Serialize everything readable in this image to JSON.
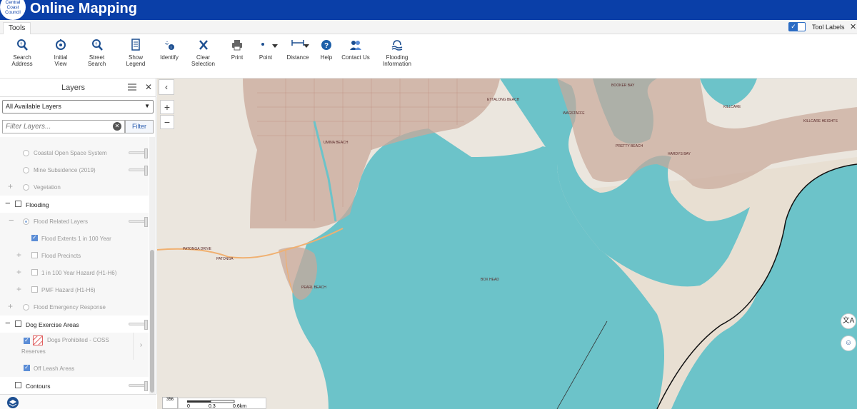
{
  "header": {
    "logo_lines": [
      "Central",
      "Coast",
      "Council"
    ],
    "title": "Online Mapping",
    "bg_color": "#0a3fa8"
  },
  "tabstrip": {
    "tab_label": "Tools",
    "tool_labels_text": "Tool Labels",
    "tool_labels_on": true,
    "close": "✕"
  },
  "toolbar": {
    "tools": [
      {
        "label": "Search Address",
        "icon": "search-address-icon"
      },
      {
        "label": "Initial View",
        "icon": "initial-view-icon"
      },
      {
        "label": "Street Search",
        "icon": "street-search-icon"
      },
      {
        "label": "Show Legend",
        "icon": "legend-icon"
      },
      {
        "label": "Identify",
        "icon": "identify-icon"
      },
      {
        "label": "Clear Selection",
        "icon": "clear-icon"
      },
      {
        "label": "Print",
        "icon": "print-icon"
      },
      {
        "label": "Point",
        "icon": "point-icon"
      },
      {
        "label": "Distance",
        "icon": "distance-icon"
      },
      {
        "label": "Help",
        "icon": "help-icon"
      },
      {
        "label": "Contact Us",
        "icon": "contact-icon"
      },
      {
        "label": "Flooding",
        "label2": "Information",
        "icon": "flooding-info-icon"
      }
    ]
  },
  "layers_panel": {
    "title": "Layers",
    "close": "✕",
    "select_value": "All Available Layers",
    "filter_placeholder": "Filter Layers...",
    "filter_button": "Filter",
    "rows": [
      {
        "label": "Coastal Open Space System"
      },
      {
        "label": "Mine Subsidence (2019)"
      },
      {
        "label": "Vegetation"
      },
      {
        "label": "Flooding"
      },
      {
        "label": "Flood Related Layers"
      },
      {
        "label": "Flood Extents 1 in 100 Year"
      },
      {
        "label": "Flood Precincts"
      },
      {
        "label": "1 in 100 Year Hazard (H1-H6)"
      },
      {
        "label": "PMF Hazard (H1-H6)"
      },
      {
        "label": "Flood Emergency Response"
      },
      {
        "label": "Dog Exercise Areas"
      },
      {
        "label": "Dogs Prohibited - COSS",
        "label2": "Reserves"
      },
      {
        "label": "Off Leash Areas"
      },
      {
        "label": "Contours"
      }
    ]
  },
  "map": {
    "water_color": "#6cc3c9",
    "land_color": "#ebe6de",
    "urban_color": "#c9a89a",
    "labels": [
      "BOOKER BAY",
      "ETTALONG BEACH",
      "UMINA BEACH",
      "WAGSTAFFE",
      "PRETTY BEACH",
      "HARDYS BAY",
      "KILLCARE",
      "KILLCARE HEIGHTS",
      "PATONGA",
      "PATONGA DRIVE",
      "PEARL BEACH",
      "BOX HEAD"
    ],
    "scale_ticks": [
      "0",
      "0.3",
      "0.6km"
    ],
    "basemap_label": "356",
    "collapse": "‹",
    "zoom_in": "+",
    "zoom_out": "−",
    "translate_btn": "文A",
    "assistant_btn": "☺"
  }
}
